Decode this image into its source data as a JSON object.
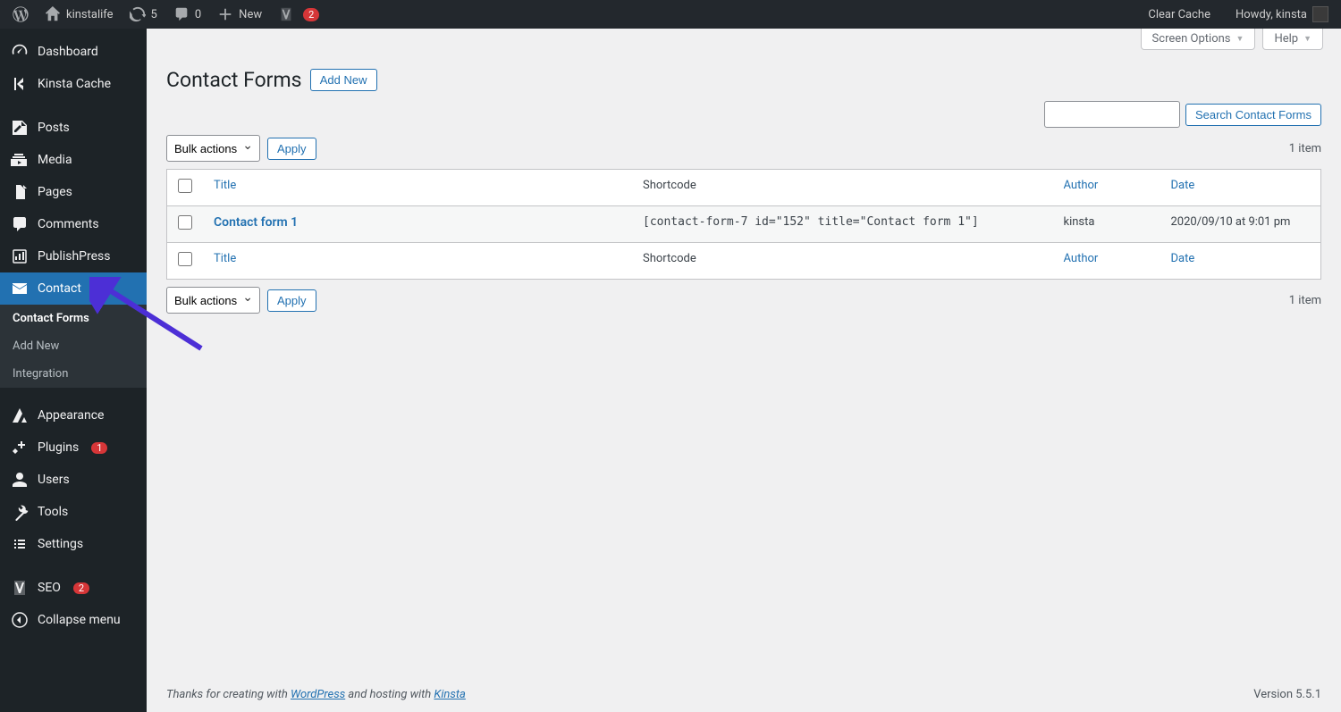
{
  "adminbar": {
    "site_name": "kinstalife",
    "updates_count": "5",
    "comments_count": "0",
    "new_label": "New",
    "yoast_count": "2",
    "clear_cache": "Clear Cache",
    "howdy": "Howdy, kinsta"
  },
  "sidebar": {
    "dashboard": "Dashboard",
    "kinsta_cache": "Kinsta Cache",
    "posts": "Posts",
    "media": "Media",
    "pages": "Pages",
    "comments": "Comments",
    "publishpress": "PublishPress",
    "contact": "Contact",
    "contact_forms": "Contact Forms",
    "add_new": "Add New",
    "integration": "Integration",
    "appearance": "Appearance",
    "plugins": "Plugins",
    "plugins_count": "1",
    "users": "Users",
    "tools": "Tools",
    "settings": "Settings",
    "seo": "SEO",
    "seo_count": "2",
    "collapse": "Collapse menu"
  },
  "screen_meta": {
    "options": "Screen Options",
    "help": "Help"
  },
  "page": {
    "title": "Contact Forms",
    "add_new": "Add New",
    "search_button": "Search Contact Forms",
    "bulk_actions": "Bulk actions",
    "apply": "Apply",
    "item_count": "1 item"
  },
  "table": {
    "headers": {
      "title": "Title",
      "shortcode": "Shortcode",
      "author": "Author",
      "date": "Date"
    },
    "rows": [
      {
        "title": "Contact form 1",
        "shortcode": "[contact-form-7 id=\"152\" title=\"Contact form 1\"]",
        "author": "kinsta",
        "date": "2020/09/10 at 9:01 pm"
      }
    ]
  },
  "footer": {
    "thanks_prefix": "Thanks for creating with ",
    "wordpress": "WordPress",
    "hosting": " and hosting with ",
    "kinsta": "Kinsta",
    "version": "Version 5.5.1"
  }
}
